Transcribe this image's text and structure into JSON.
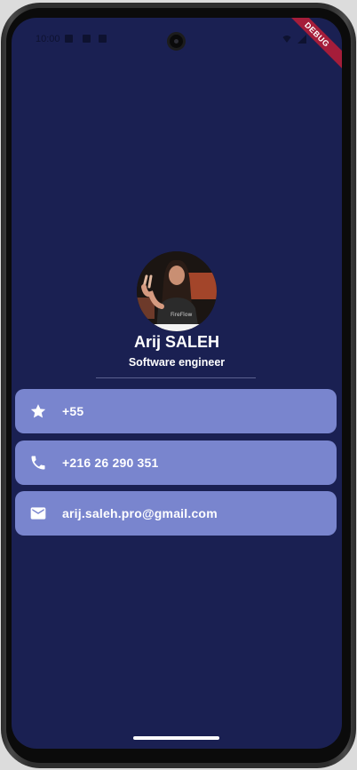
{
  "status_bar": {
    "time": "10:00"
  },
  "debug_banner": "DEBUG",
  "profile": {
    "name": "Arij SALEH",
    "title": "Software engineer"
  },
  "contacts": [
    {
      "icon": "star-icon",
      "value": "+55"
    },
    {
      "icon": "phone-icon",
      "value": "+216 26 290 351"
    },
    {
      "icon": "email-icon",
      "value": "arij.saleh.pro@gmail.com"
    }
  ],
  "colors": {
    "background": "#1a2052",
    "card": "#7985ce",
    "text": "#ffffff",
    "debug": "#a51d3a"
  }
}
